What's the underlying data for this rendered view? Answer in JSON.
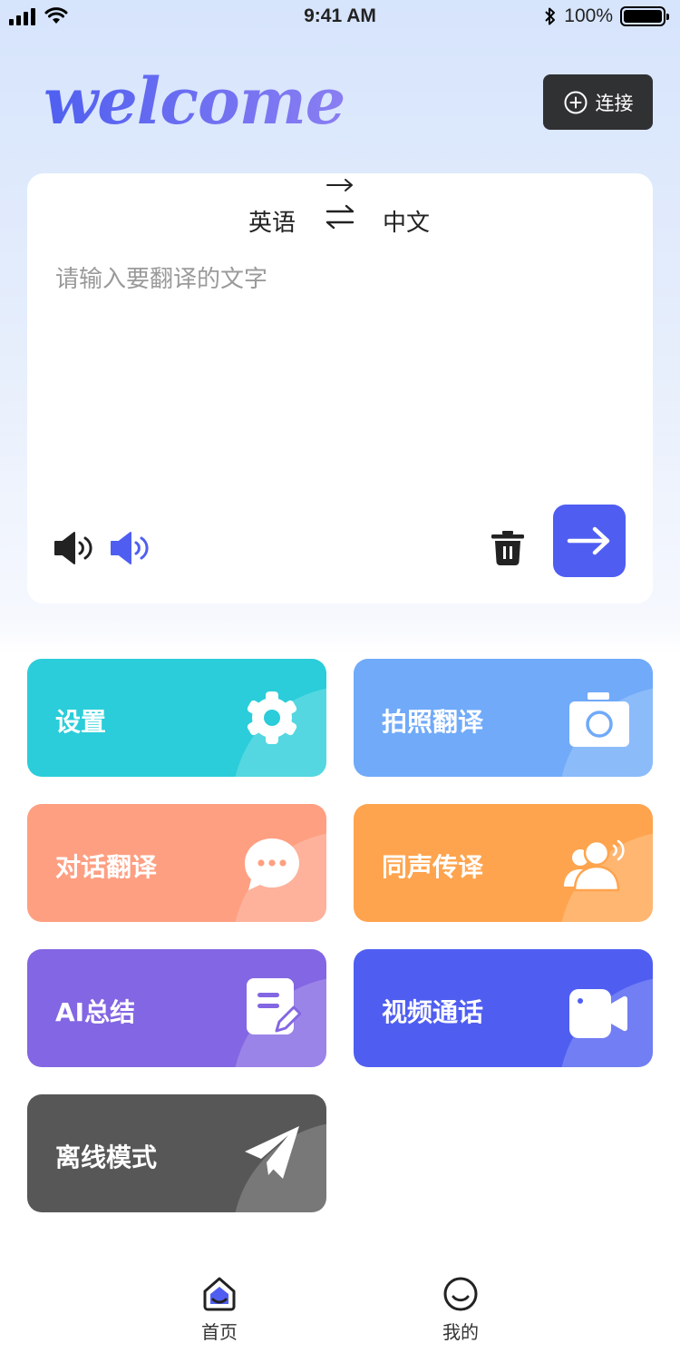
{
  "status_bar": {
    "time": "9:41 AM",
    "battery_percent": "100%",
    "battery_level": 1.0
  },
  "header": {
    "welcome_text": "welcome",
    "connect_label": "连接"
  },
  "translator": {
    "source_language": "英语",
    "target_language": "中文",
    "input_placeholder": "请输入要翻译的文字",
    "input_value": ""
  },
  "features": [
    {
      "label": "设置",
      "color": "#2acdd9",
      "icon": "gear-icon"
    },
    {
      "label": "拍照翻译",
      "color": "#70aaf9",
      "icon": "camera-icon"
    },
    {
      "label": "对话翻译",
      "color": "#fe9f82",
      "icon": "chat-bubble-icon"
    },
    {
      "label": "同声传译",
      "color": "#fea44e",
      "icon": "people-sound-icon"
    },
    {
      "label": "AI总结",
      "color": "#8366e3",
      "icon": "note-edit-icon"
    },
    {
      "label": "视频通话",
      "color": "#4f5ef1",
      "icon": "video-camera-icon"
    },
    {
      "label": "离线模式",
      "color": "#575757",
      "icon": "paper-plane-icon"
    }
  ],
  "tab_bar": {
    "home_label": "首页",
    "mine_label": "我的"
  },
  "colors": {
    "accent": "#4f5ef1",
    "dark_button": "#303133"
  }
}
